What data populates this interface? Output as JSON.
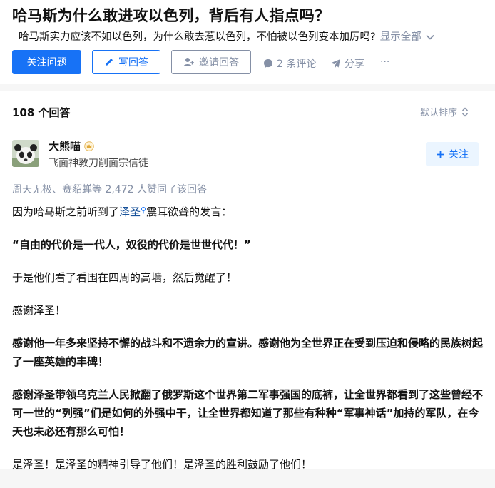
{
  "question": {
    "title": "哈马斯为什么敢进攻以色列，背后有人指点吗？",
    "description": "哈马斯实力应该不如以色列，为什么敢去惹以色列，不怕被以色列变本加厉吗?",
    "show_all": "显示全部"
  },
  "actions": {
    "follow_label": "关注问题",
    "write_label": "写回答",
    "invite_label": "邀请回答",
    "comments_label": "2 条评论",
    "share_label": "分享",
    "more_label": "···"
  },
  "answers": {
    "count_label": "108 个回答",
    "sort_label": "默认排序"
  },
  "answer": {
    "author_name": "大熊喵",
    "author_headline": "飞面神教刀削面宗信徒",
    "follow_label": "关注",
    "voters_text": "周天无极、赛貂蝉等 2,472 人赞同了该回答",
    "para1_pre": "因为哈马斯之前听到了",
    "para1_link": "泽圣",
    "para1_post": "震耳欲聋的发言：",
    "para2": "“自由的代价是一代人，奴役的代价是世世代代！”",
    "para3": "于是他们看了看围在四周的高墙，然后觉醒了！",
    "para4": "感谢泽圣！",
    "para5": "感谢他一年多来坚持不懈的战斗和不遗余力的宣讲。感谢他为全世界正在受到压迫和侵略的民族树起了一座英雄的丰碑！",
    "para6": "感谢泽圣带领乌克兰人民掀翻了俄罗斯这个世界第二军事强国的底裤，让全世界都看到了这些曾经不可一世的“列强”们是如何的外强中干，让全世界都知道了那些有种种“军事神话”加持的军队，在今天也未必还有那么可怕！",
    "para7": "是泽圣！是泽圣的精神引导了他们！是泽圣的胜利鼓励了他们！"
  },
  "colors": {
    "primary": "#1772f6",
    "muted": "#8590a6",
    "text": "#121212"
  }
}
